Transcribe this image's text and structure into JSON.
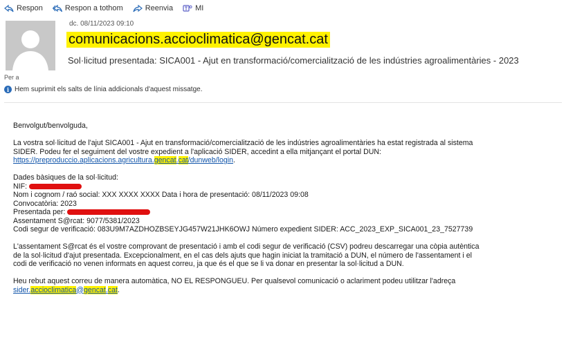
{
  "toolbar": {
    "reply": "Respon",
    "reply_all": "Respon a tothom",
    "forward": "Reenvia",
    "more": "MI"
  },
  "email": {
    "date": "dc. 08/11/2023 09:10",
    "sender": "comunicacions.accioclimatica@gencat.cat",
    "subject": "Sol·licitud presentada: SICA001 - Ajut en transformació/comercialització de les indústries agroalimentàries - 2023",
    "to_label": "Per a",
    "notice": "Hem suprimit els salts de línia addicionals d'aquest missatge."
  },
  "body": {
    "greeting": "Benvolgut/benvolguda,",
    "para1_line1": "La vostra sol·licitud de l'ajut SICA001 - Ajut en transformació/comercialització de les indústries agroalimentàries ha estat registrada al sistema",
    "para1_line2": "SIDER. Podeu fer el seguiment del vostre expedient a l'aplicació SIDER, accedint a ella mitjançant el portal DUN:",
    "link_a": "https://preproduccio.aplicacions.agricultura.",
    "link_b": "gencat",
    "link_c": ".",
    "link_d": "cat",
    "link_e": "/dunweb/login",
    "link_end": ".",
    "basics_title": "Dades bàsiques de la sol·licitud:",
    "nif_label": "NIF:",
    "name_line": "Nom i cognom / raó social:  XXX XXXX XXXX Data i hora de presentació: 08/11/2023 09:08",
    "convocatoria": "Convocatòria: 2023",
    "presentada_label": "Presentada per:",
    "assentament": "Assentament S@rcat:  9077/5381/2023",
    "codi": "Codi segur de verificació: 083U9M7AZDHOZBSEYJG457W21JHK6OWJ Número expedient SIDER:  ACC_2023_EXP_SICA001_23_7527739",
    "para2_line1": "L'assentament S@rcat és el vostre comprovant de presentació i amb el codi segur de verificació (CSV) podreu descarregar una còpia autèntica",
    "para2_line2": "de la sol·licitud d'ajut presentada. Excepcionalment, en el cas dels ajuts que hagin iniciat la tramitació a DUN, el número de l'assentament i el",
    "para2_line3": "codi de verificació no venen informats en aquest correu, ja que és el que se li va donar en presentar la sol·licitud a DUN.",
    "para3_line1": "Heu rebut aquest correu de manera automàtica, NO EL RESPONGUEU. Per qualsevol comunicació o aclariment podeu utilitzar l'adreça",
    "mail_a": "sider.",
    "mail_b": "accioclimatica",
    "mail_c": "@",
    "mail_d": "gencat",
    "mail_e": ".",
    "mail_f": "cat",
    "mail_end": "."
  },
  "colors": {
    "highlight": "#fff200",
    "link": "#1155aa",
    "redaction": "#e01010"
  }
}
